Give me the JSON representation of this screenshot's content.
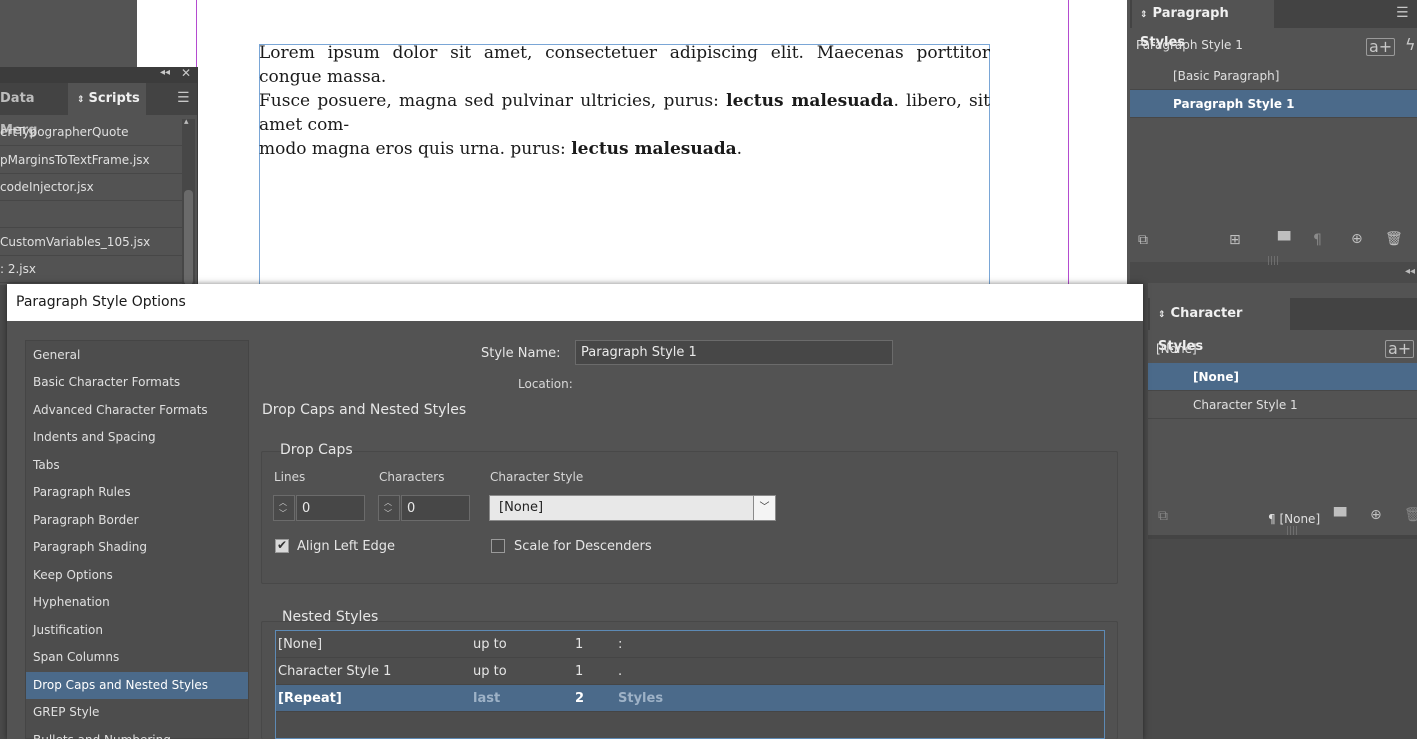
{
  "document": {
    "line1": "Lorem ipsum dolor sit amet, consectetuer adipiscing elit. Maecenas porttitor congue massa.",
    "line2_pre": "Fusce posuere, magna sed pulvinar ultricies, purus: ",
    "line2_bold": "lectus malesuada",
    "line2_post": ". libero, sit amet com-",
    "line3_pre": "modo magna eros quis urna. purus: ",
    "line3_bold": "lectus malesuada",
    "line3_post": "."
  },
  "scripts_panel": {
    "tab_data_merge": "Data Merg",
    "tab_scripts": "Scripts",
    "items": [
      "ertTypographerQuote",
      "pMarginsToTextFrame.jsx",
      "codeInjector.jsx",
      "",
      "CustomVariables_105.jsx",
      ": 2.jsx"
    ]
  },
  "paragraph_styles_panel": {
    "title": "Paragraph Styles",
    "current_style": "Paragraph Style 1",
    "items": [
      "[Basic Paragraph]",
      "Paragraph Style 1"
    ],
    "selected_index": 1
  },
  "character_styles_panel": {
    "title": "Character Styles",
    "current_style": "[None]",
    "items": [
      "[None]",
      "Character Style 1"
    ],
    "selected_index": 0,
    "footer_label": "¶ [None]"
  },
  "dialog": {
    "title": "Paragraph Style Options",
    "categories": [
      "General",
      "Basic Character Formats",
      "Advanced Character Formats",
      "Indents and Spacing",
      "Tabs",
      "Paragraph Rules",
      "Paragraph Border",
      "Paragraph Shading",
      "Keep Options",
      "Hyphenation",
      "Justification",
      "Span Columns",
      "Drop Caps and Nested Styles",
      "GREP Style",
      "Bullets and Numbering"
    ],
    "selected_category_index": 12,
    "style_name_label": "Style Name:",
    "style_name_value": "Paragraph Style 1",
    "location_label": "Location:",
    "section_title": "Drop Caps and Nested Styles",
    "drop_caps": {
      "group_title": "Drop Caps",
      "lines_label": "Lines",
      "lines_value": "0",
      "characters_label": "Characters",
      "characters_value": "0",
      "char_style_label": "Character Style",
      "char_style_value": "[None]",
      "align_left_edge_label": "Align Left Edge",
      "align_left_edge_checked": true,
      "scale_descenders_label": "Scale for Descenders",
      "scale_descenders_checked": false
    },
    "nested_styles": {
      "group_title": "Nested Styles",
      "rows": [
        {
          "style": "[None]",
          "mode": "up to",
          "count": "1",
          "delim": ":"
        },
        {
          "style": "Character Style 1",
          "mode": "up to",
          "count": "1",
          "delim": "."
        },
        {
          "style": "[Repeat]",
          "mode": "last",
          "count": "2",
          "delim": "Styles"
        }
      ],
      "selected_index": 2
    }
  }
}
